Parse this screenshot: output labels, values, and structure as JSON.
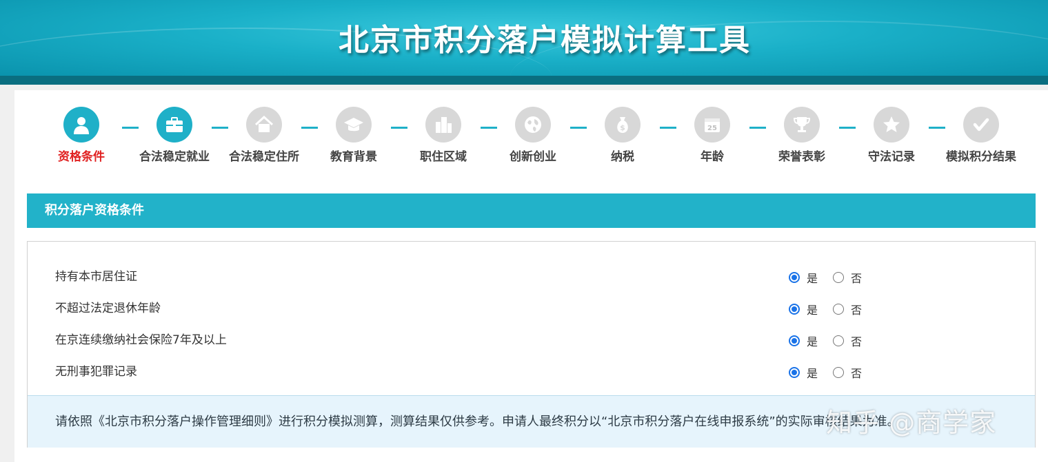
{
  "header": {
    "title": "北京市积分落户模拟计算工具"
  },
  "steps": [
    {
      "label": "资格条件",
      "icon": "person-icon",
      "active": true,
      "current": true
    },
    {
      "label": "合法稳定就业",
      "icon": "briefcase-icon",
      "active": true,
      "current": false
    },
    {
      "label": "合法稳定住所",
      "icon": "house-icon",
      "active": false,
      "current": false
    },
    {
      "label": "教育背景",
      "icon": "graduation-cap-icon",
      "active": false,
      "current": false
    },
    {
      "label": "职住区域",
      "icon": "buildings-icon",
      "active": false,
      "current": false
    },
    {
      "label": "创新创业",
      "icon": "globe-icon",
      "active": false,
      "current": false
    },
    {
      "label": "纳税",
      "icon": "money-bag-icon",
      "active": false,
      "current": false
    },
    {
      "label": "年龄",
      "icon": "calendar-icon",
      "calendar_day": "25",
      "active": false,
      "current": false
    },
    {
      "label": "荣誉表彰",
      "icon": "trophy-icon",
      "active": false,
      "current": false
    },
    {
      "label": "守法记录",
      "icon": "star-icon",
      "active": false,
      "current": false
    },
    {
      "label": "模拟积分结果",
      "icon": "checkmark-icon",
      "active": false,
      "current": false
    }
  ],
  "section": {
    "title": "积分落户资格条件"
  },
  "conditions": [
    {
      "label": "持有本市居住证",
      "yes": "是",
      "no": "否",
      "selected": "yes"
    },
    {
      "label": "不超过法定退休年龄",
      "yes": "是",
      "no": "否",
      "selected": "yes"
    },
    {
      "label": "在京连续缴纳社会保险7年及以上",
      "yes": "是",
      "no": "否",
      "selected": "yes"
    },
    {
      "label": "无刑事犯罪记录",
      "yes": "是",
      "no": "否",
      "selected": "yes"
    }
  ],
  "notice": {
    "text": "请依照《北京市积分落户操作管理细则》进行积分模拟测算，测算结果仅供参考。申请人最终积分以“北京市积分落户在线申报系统”的实际审核结果为准。"
  },
  "watermark": {
    "text": "知乎 @商学家"
  },
  "colors": {
    "accent": "#1fb0c8",
    "banner_dark": "#0a6e80",
    "current_step": "#e02020",
    "radio": "#1a73e8",
    "notice_bg": "#e6f4fc"
  }
}
